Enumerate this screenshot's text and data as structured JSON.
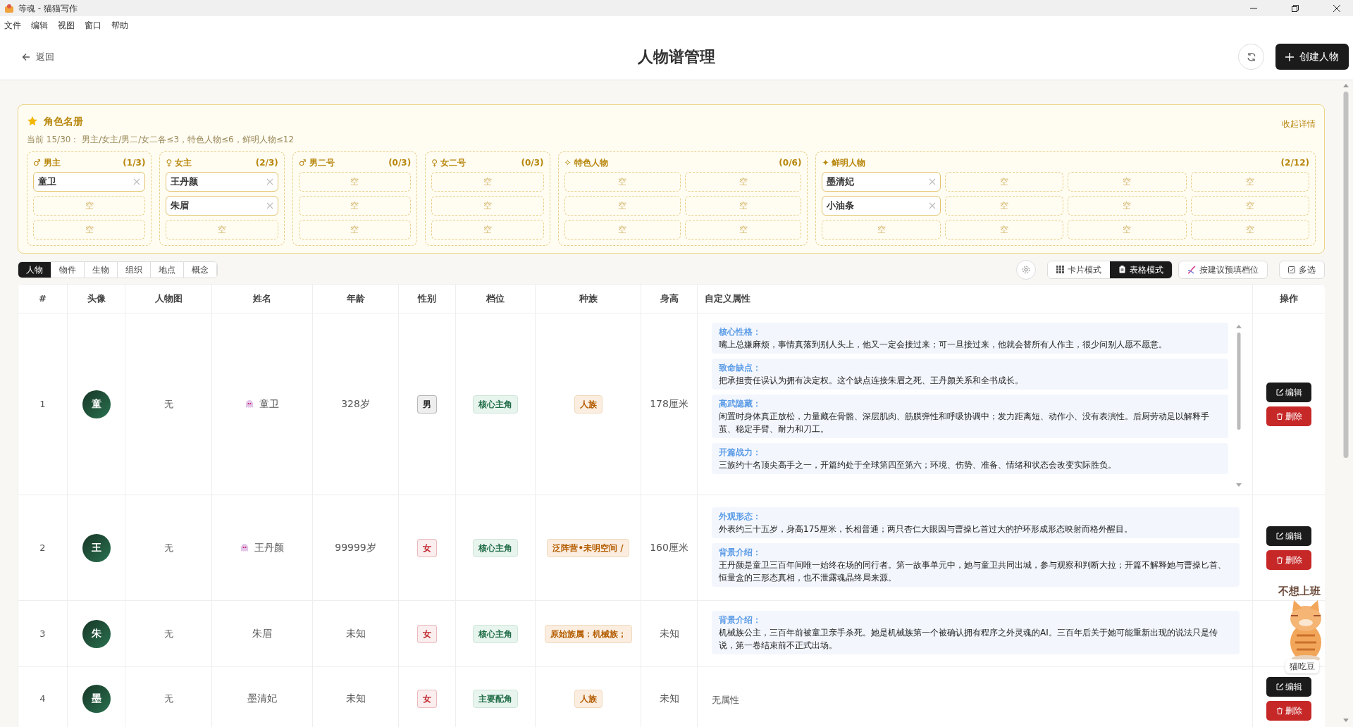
{
  "window": {
    "title": "等魂 - 猫猫写作"
  },
  "menu": [
    "文件",
    "编辑",
    "视图",
    "窗口",
    "帮助"
  ],
  "header": {
    "back": "返回",
    "title": "人物谱管理",
    "create": "创建人物"
  },
  "roster": {
    "title": "角色名册",
    "summary": "当前 15/30： 男主/女主/男二/女二各≤3，特色人物≤6，鲜明人物≤12",
    "collapse": "收起详情",
    "groups": [
      {
        "symbol": "♂",
        "label": "男主",
        "count": "(1/3)",
        "slots": [
          {
            "kind": "filled",
            "name": "童卫"
          },
          {
            "kind": "empty",
            "name": "空"
          },
          {
            "kind": "empty",
            "name": "空"
          }
        ]
      },
      {
        "symbol": "♀",
        "label": "女主",
        "count": "(2/3)",
        "slots": [
          {
            "kind": "filled",
            "name": "王丹颜"
          },
          {
            "kind": "filled",
            "name": "朱眉"
          },
          {
            "kind": "empty",
            "name": "空"
          }
        ]
      },
      {
        "symbol": "♂",
        "label": "男二号",
        "count": "(0/3)",
        "slots": [
          {
            "kind": "empty",
            "name": "空"
          },
          {
            "kind": "empty",
            "name": "空"
          },
          {
            "kind": "empty",
            "name": "空"
          }
        ]
      },
      {
        "symbol": "♀",
        "label": "女二号",
        "count": "(0/3)",
        "slots": [
          {
            "kind": "empty",
            "name": "空"
          },
          {
            "kind": "empty",
            "name": "空"
          },
          {
            "kind": "empty",
            "name": "空"
          }
        ]
      },
      {
        "symbol": "✧",
        "label": "特色人物",
        "count": "(0/6)",
        "slots": [
          {
            "kind": "empty",
            "name": "空"
          },
          {
            "kind": "empty",
            "name": "空"
          },
          {
            "kind": "empty",
            "name": "空"
          },
          {
            "kind": "empty",
            "name": "空"
          },
          {
            "kind": "empty",
            "name": "空"
          },
          {
            "kind": "empty",
            "name": "空"
          }
        ]
      },
      {
        "symbol": "✦",
        "label": "鲜明人物",
        "count": "(2/12)",
        "slots": [
          {
            "kind": "filled",
            "name": "墨清妃"
          },
          {
            "kind": "filled",
            "name": "小油条"
          },
          {
            "kind": "empty",
            "name": "空"
          },
          {
            "kind": "empty",
            "name": "空"
          },
          {
            "kind": "empty",
            "name": "空"
          },
          {
            "kind": "empty",
            "name": "空"
          },
          {
            "kind": "empty",
            "name": "空"
          },
          {
            "kind": "empty",
            "name": "空"
          },
          {
            "kind": "empty",
            "name": "空"
          },
          {
            "kind": "empty",
            "name": "空"
          },
          {
            "kind": "empty",
            "name": "空"
          },
          {
            "kind": "empty",
            "name": "空"
          }
        ]
      }
    ]
  },
  "category_tabs": [
    {
      "label": "人物",
      "selected": true
    },
    {
      "label": "物件",
      "selected": false
    },
    {
      "label": "生物",
      "selected": false
    },
    {
      "label": "组织",
      "selected": false
    },
    {
      "label": "地点",
      "selected": false
    },
    {
      "label": "概念",
      "selected": false
    }
  ],
  "view_modes": [
    {
      "label": "卡片模式",
      "selected": false
    },
    {
      "label": "表格模式",
      "selected": true
    }
  ],
  "prefill": "按建议预填档位",
  "multi_select": "多选",
  "table": {
    "columns": [
      "#",
      "头像",
      "人物图",
      "姓名",
      "年龄",
      "性别",
      "档位",
      "种族",
      "身高",
      "自定义属性",
      "操作"
    ],
    "rows": [
      {
        "index": "1",
        "avatar": "童",
        "portrait": "无",
        "name": "童卫",
        "name_icon": true,
        "age": "328岁",
        "gender": "男",
        "color": "#222222",
        "tier": "核心主角",
        "race": "人族",
        "height": "178厘米",
        "scrollable": true,
        "attributes": [
          {
            "label": "核心性格：",
            "text": "嘴上总嫌麻烦，事情真落到别人头上，他又一定会接过来；可一旦接过来，他就会替所有人作主，很少问别人愿不愿意。"
          },
          {
            "label": "致命缺点：",
            "text": "把承担责任误认为拥有决定权。这个缺点连接朱眉之死、王丹颜关系和全书成长。"
          },
          {
            "label": "高武隐藏：",
            "text": "闲置时身体真正放松，力量藏在骨骼、深层肌肉、筋膜弹性和呼吸协调中；发力距离短、动作小、没有表演性。后厨劳动足以解释手茧、稳定手臂、耐力和刀工。"
          },
          {
            "label": "开篇战力：",
            "text": "三族约十名顶尖高手之一，开篇约处于全球第四至第六；环境、伤势、准备、情绪和状态会改变实际胜负。"
          }
        ],
        "actions": [
          "编辑",
          "删除"
        ]
      },
      {
        "index": "2",
        "avatar": "王",
        "portrait": "无",
        "name": "王丹颜",
        "name_icon": true,
        "age": "99999岁",
        "gender": "女",
        "color": "#c0262d",
        "tier": "核心主角",
        "race": "泛阵营•未明空间 /",
        "height": "160厘米",
        "attributes": [
          {
            "label": "外观形态：",
            "text": "外表约三十五岁，身高175厘米，长相普通；两只杏仁大眼因与曹操匕首过大的护环形成形态映射而格外醒目。"
          },
          {
            "label": "背景介绍：",
            "text": "王丹颜是童卫三百年间唯一始终在场的同行者。第一故事单元中，她与童卫共同出城，参与观察和判断大拉；开篇不解释她与曹操匕首、恒量盒的三形态真相，也不泄露魂晶终局来源。"
          }
        ],
        "actions": [
          "编辑",
          "删除"
        ]
      },
      {
        "index": "3",
        "avatar": "朱",
        "portrait": "无",
        "name": "朱眉",
        "age": "未知",
        "gender": "女",
        "color": "#c0262d",
        "tier": "核心主角",
        "race": "原始族属：机械族；",
        "height": "未知",
        "attributes": [
          {
            "label": "背景介绍：",
            "text": "机械族公主，三百年前被童卫亲手杀死。她是机械族第一个被确认拥有程序之外灵魂的AI。三百年后关于她可能重新出现的说法只是传说，第一卷结束前不正式出场。"
          }
        ]
      },
      {
        "index": "4",
        "avatar": "墨",
        "portrait": "无",
        "name": "墨清妃",
        "age": "未知",
        "gender": "女",
        "color": "#c0262d",
        "tier": "主要配角",
        "race": "人族",
        "height": "未知",
        "attributes_empty": "无属性",
        "actions": [
          "编辑",
          "删除"
        ]
      }
    ]
  },
  "pet": {
    "sticker_text": "不想上班",
    "caption": "猫吃豆"
  }
}
